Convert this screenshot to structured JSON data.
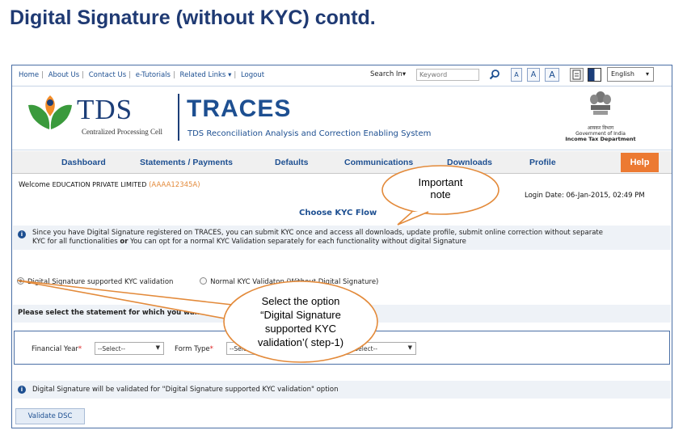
{
  "slide": {
    "title": "Digital Signature (without KYC) contd."
  },
  "topbar": {
    "links": [
      "Home",
      "About Us",
      "Contact Us",
      "e-Tutorials",
      "Related Links",
      "Logout"
    ],
    "search_label": "Search In",
    "search_placeholder": "Keyword",
    "font_sizes": [
      "A",
      "A",
      "A"
    ],
    "language": "English"
  },
  "brand": {
    "tds": "TDS",
    "tds_sub": "Centralized Processing Cell",
    "traces": "TRACES",
    "traces_sub": "TDS Reconciliation Analysis and Correction Enabling System",
    "gov_hindi": "आयकर विभाग",
    "gov_line1": "Government of India",
    "gov_line2": "Income Tax Department"
  },
  "nav": {
    "items": [
      "Dashboard",
      "Statements / Payments",
      "Defaults",
      "Communications",
      "Downloads",
      "Profile"
    ],
    "help": "Help"
  },
  "welcome": {
    "prefix": "Welcome",
    "org": "EDUCATION PRIVATE LIMITED",
    "pan": "(AAAA12345A)"
  },
  "login_date": "Login Date: 06-Jan-2015, 02:49 PM",
  "section_title": "Choose KYC Flow",
  "info": {
    "line1": "Since you have Digital Signature registered on TRACES, you can submit KYC once and access all downloads, update profile, submit online correction without separate",
    "line2_a": "KYC for all functionalities",
    "line2_or": "or",
    "line2_b": "You can opt for a normal KYC Validation separately for each functionality without digital Signature"
  },
  "radios": {
    "option1": "Digital Signature supported KYC validation",
    "option2": "Normal KYC Validaton (Without Digital Signature)"
  },
  "select_statement": "Please select the statement for which you want",
  "filters": {
    "financial_year_label": "Financial Year",
    "financial_year_value": "--Select--",
    "form_type_label": "Form Type",
    "form_type_value": "--Select--",
    "quarter_value": "--Select--"
  },
  "info2": "Digital Signature will be validated for \"Digital Signature supported KYC validation\" option",
  "validate_button": "Validate DSC",
  "callouts": {
    "important_1": "Important",
    "important_2": "note",
    "step_1": "Select  the option",
    "step_2": "“Digital Signature",
    "step_3": "supported KYC",
    "step_4": "validation’( step-1)"
  },
  "colors": {
    "navy": "#1d4f91",
    "orange": "#ec7a32",
    "callout_border": "#e38a3a"
  }
}
